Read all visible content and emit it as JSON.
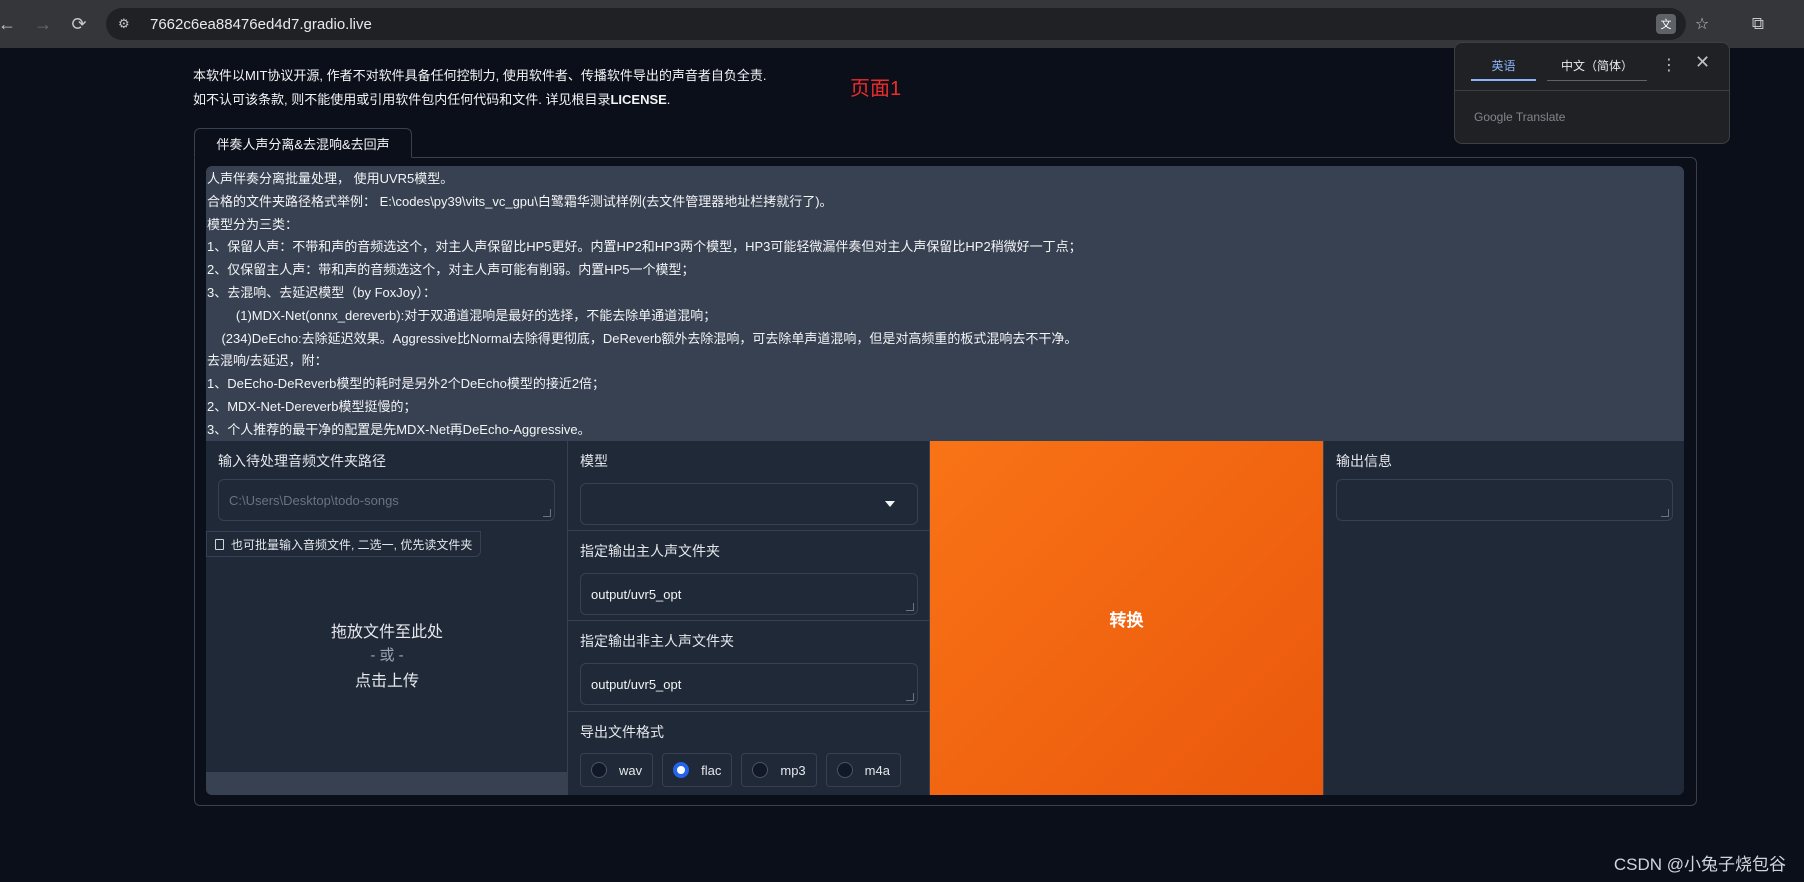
{
  "browser": {
    "url": "7662c6ea88476ed4d7.gradio.live",
    "back_icon": "←",
    "forward_icon": "→",
    "reload_icon": "⟳"
  },
  "license": {
    "line1": "本软件以MIT协议开源, 作者不对软件具备任何控制力, 使用软件者、传播软件导出的声音者自负全责.",
    "line2_prefix": "如不认可该条款, 则不能使用或引用软件包内任何代码和文件. 详见根目录",
    "line2_bold": "LICENSE",
    "line2_suffix": "."
  },
  "annotation": "页面1",
  "tab": {
    "label": "伴奏人声分离&去混响&去回声"
  },
  "markdown_lines": [
    "人声伴奏分离批量处理， 使用UVR5模型。",
    "合格的文件夹路径格式举例： E:\\codes\\py39\\vits_vc_gpu\\白鹭霜华测试样例(去文件管理器地址栏拷就行了)。",
    "模型分为三类：",
    "1、保留人声：不带和声的音频选这个，对主人声保留比HP5更好。内置HP2和HP3两个模型，HP3可能轻微漏伴奏但对主人声保留比HP2稍微好一丁点；",
    "2、仅保留主人声：带和声的音频选这个，对主人声可能有削弱。内置HP5一个模型；",
    "3、去混响、去延迟模型（by FoxJoy）：",
    "        (1)MDX-Net(onnx_dereverb):对于双通道混响是最好的选择，不能去除单通道混响；",
    "    (234)DeEcho:去除延迟效果。Aggressive比Normal去除得更彻底，DeReverb额外去除混响，可去除单声道混响，但是对高频重的板式混响去不干净。",
    "去混响/去延迟，附：",
    "1、DeEcho-DeReverb模型的耗时是另外2个DeEcho模型的接近2倍；",
    "2、MDX-Net-Dereverb模型挺慢的；",
    "3、个人推荐的最干净的配置是先MDX-Net再DeEcho-Aggressive。"
  ],
  "input_dir": {
    "label": "输入待处理音频文件夹路径",
    "placeholder": "C:\\Users\\Desktop\\todo-songs"
  },
  "file_upload": {
    "label": "也可批量输入音频文件, 二选一, 优先读文件夹",
    "drop_text": "拖放文件至此处",
    "or_text": "- 或 -",
    "click_text": "点击上传"
  },
  "model": {
    "label": "模型",
    "value": ""
  },
  "vocal_out": {
    "label": "指定输出主人声文件夹",
    "value": "output/uvr5_opt"
  },
  "ins_out": {
    "label": "指定输出非主人声文件夹",
    "value": "output/uvr5_opt"
  },
  "format": {
    "label": "导出文件格式",
    "options": [
      "wav",
      "flac",
      "mp3",
      "m4a"
    ],
    "selected": "flac"
  },
  "convert_button": "转换",
  "output_info": {
    "label": "输出信息",
    "value": ""
  },
  "google_translate": {
    "source_lang": "英语",
    "target_lang": "中文（简体）",
    "brand": "Google Translate",
    "close_icon": "✕",
    "more_icon": "⋮"
  },
  "watermark": "CSDN @小兔子烧包谷"
}
